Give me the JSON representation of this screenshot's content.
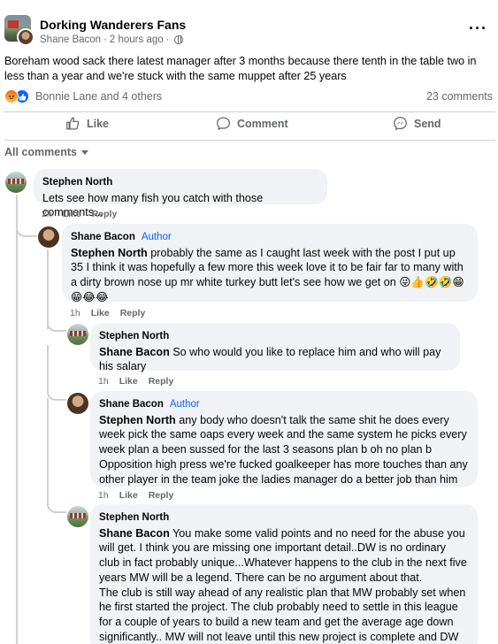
{
  "post": {
    "group_name": "Dorking Wanderers Fans",
    "author": "Shane Bacon",
    "time": "2 hours ago",
    "separator": "·",
    "more": "···",
    "text": "Boreham wood sack there latest manager after 3 months because there tenth in the table two in less than a year and we're stuck with the same muppet after 25 years",
    "reactions_text": "Bonnie Lane and 4 others",
    "comment_count": "23 comments",
    "reaction_icons": [
      "angry-icon",
      "like-icon"
    ]
  },
  "actions": {
    "like": "Like",
    "comment": "Comment",
    "send": "Send"
  },
  "filter_label": "All comments",
  "comments": [
    {
      "author": "Stephen North",
      "text": "Lets see how many fish you catch with those comments...",
      "time": "2h",
      "like": "Like",
      "reply": "Reply"
    },
    {
      "author": "Shane Bacon",
      "badge": "Author",
      "mention": "Stephen North",
      "text": "probably the same as I caught last week with the post I put up 35 I think it was hopefully a few more this week love it to be fair far to many with a dirty brown nose up mr white turkey butt let's see how we get on 😜👍🤣🤣😁",
      "text2": "😁😂😂",
      "time": "1h",
      "like": "Like",
      "reply": "Reply"
    },
    {
      "author": "Stephen North",
      "mention": "Shane Bacon",
      "text": "So who would you like to replace him and who will pay his salary",
      "time": "1h",
      "like": "Like",
      "reply": "Reply"
    },
    {
      "author": "Shane Bacon",
      "badge": "Author",
      "mention": "Stephen North",
      "text": "any body who doesn't talk the same shit he does every week pick the same oaps every week and the same system he picks every week plan a been sussed for the last 3 seasons plan b oh no plan b Opposition high press we're fucked goalkeeper has more touches than any other player in the team joke the ladies manager do a better job than him",
      "time": "1h",
      "like": "Like",
      "reply": "Reply"
    },
    {
      "author": "Stephen North",
      "mention": "Shane Bacon",
      "text": "You make some valid points and no need for the abuse you will get. I think you are missing one important detail..DW is no ordinary club in fact probably unique...Whatever happens to the club in the next five years MW will be a legend. There can be no argument about that.",
      "text2": "The club is still way ahead of any realistic plan that MW probably set when he first started the project. The club probably need to settle in this league for a couple of years to build a new team and get the average age down significantly.. MW will not leave until this new project is complete and DW"
    }
  ]
}
